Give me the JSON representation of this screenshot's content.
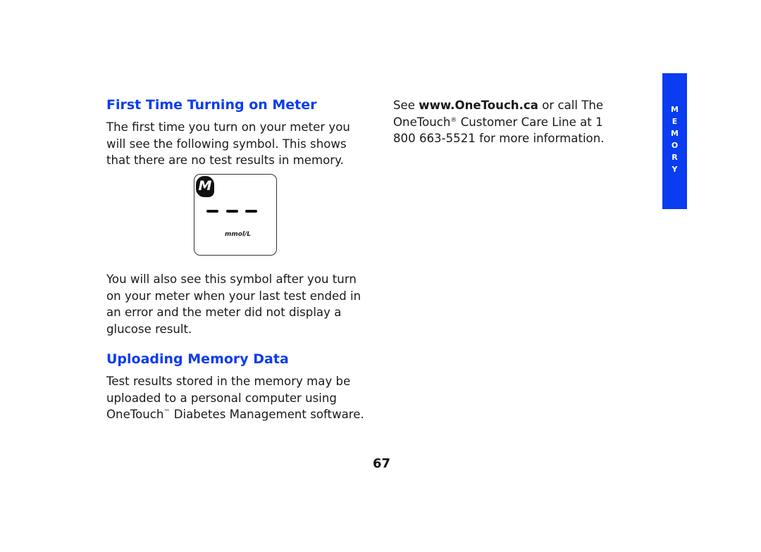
{
  "section1": {
    "heading": "First Time Turning on Meter",
    "intro": "The first time you turn on your meter you will see the following symbol. This shows that there are no test results in memory.",
    "followup": "You will also see this symbol after you turn on your meter when your last test ended in an error and the meter did not display a glucose result."
  },
  "meter_display": {
    "memory_icon_letter": "M",
    "unit": "mmol/L"
  },
  "section2": {
    "heading": "Uploading Memory Data",
    "body_before": "Test results stored in the memory may be uploaded to a personal computer using OneTouch",
    "body_tm": "™",
    "body_after": " Diabetes Management software."
  },
  "contact": {
    "see": "See ",
    "url": "www.OneTouch.ca",
    "or_call": " or call The OneTouch",
    "reg": "®",
    "care_line": " Customer Care Line at 1 800 663-5521 for more information."
  },
  "side_tab": {
    "letters": [
      "M",
      "E",
      "M",
      "O",
      "R",
      "Y"
    ],
    "color": "#0a3cf0"
  },
  "page_number": "67"
}
